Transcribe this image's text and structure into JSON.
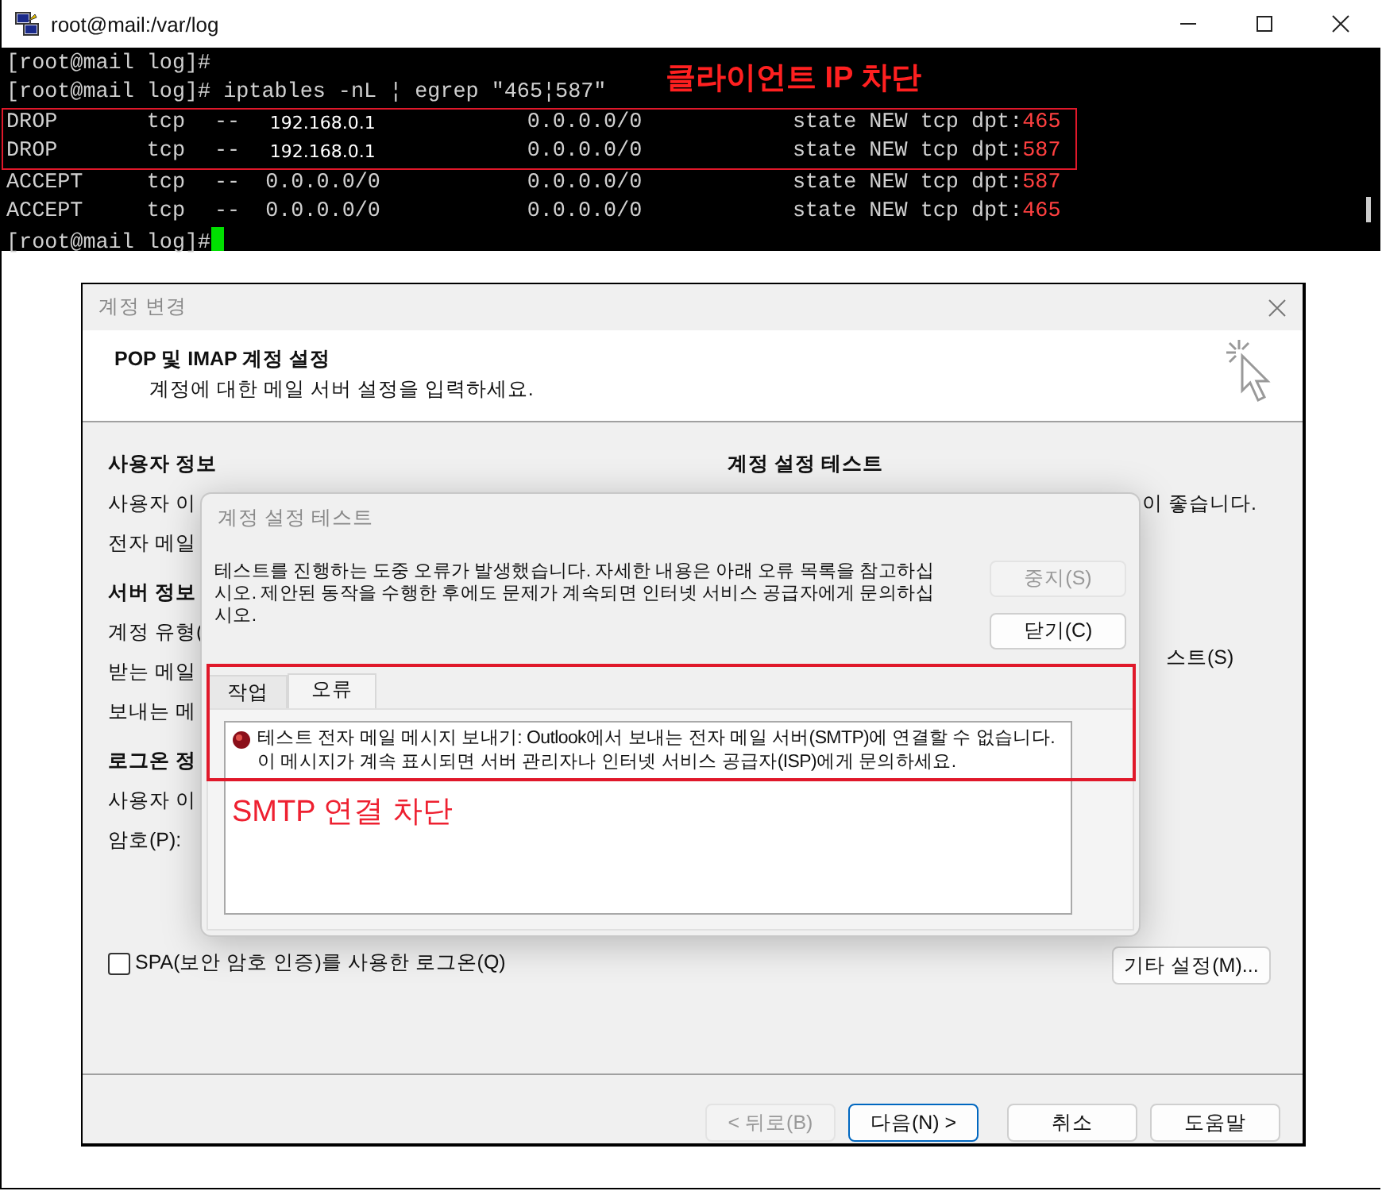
{
  "terminal": {
    "title": "root@mail:/var/log",
    "lines": [
      "[root@mail log]#",
      "[root@mail log]# iptables -nL ¦ egrep \"465¦587\""
    ],
    "annotation": "클라이언트 IP 차단",
    "rules": [
      {
        "target": "DROP",
        "prot": "tcp",
        "opt": "--",
        "source": "192.168.0.1",
        "destination": "0.0.0.0/0",
        "match": "state NEW tcp dpt:",
        "port": "465",
        "boxed": true
      },
      {
        "target": "DROP",
        "prot": "tcp",
        "opt": "--",
        "source": "192.168.0.1",
        "destination": "0.0.0.0/0",
        "match": "state NEW tcp dpt:",
        "port": "587",
        "boxed": true
      },
      {
        "target": "ACCEPT",
        "prot": "tcp",
        "opt": "--",
        "source": "0.0.0.0/0",
        "destination": "0.0.0.0/0",
        "match": "state NEW tcp dpt:",
        "port": "587",
        "boxed": false
      },
      {
        "target": "ACCEPT",
        "prot": "tcp",
        "opt": "--",
        "source": "0.0.0.0/0",
        "destination": "0.0.0.0/0",
        "match": "state NEW tcp dpt:",
        "port": "465",
        "boxed": false
      }
    ],
    "prompt": "[root@mail log]#"
  },
  "account_dialog": {
    "title": "계정 변경",
    "heading": "POP 및 IMAP 계정 설정",
    "subheading": "계정에 대한 메일 서버 설정을 입력하세요.",
    "left": [
      {
        "kind": "section",
        "text": "사용자 정보"
      },
      {
        "kind": "label",
        "text": "사용자 이"
      },
      {
        "kind": "label",
        "text": "전자 메일"
      },
      {
        "kind": "section",
        "text": "서버 정보"
      },
      {
        "kind": "label",
        "text": "계정 유형("
      },
      {
        "kind": "label",
        "text": "받는 메일"
      },
      {
        "kind": "label",
        "text": "보내는 메"
      },
      {
        "kind": "section",
        "text": "로그온 정"
      },
      {
        "kind": "label",
        "text": "사용자 이"
      },
      {
        "kind": "label",
        "text": "암호(P):"
      }
    ],
    "right": [
      {
        "kind": "section",
        "text": "계정 설정 테스트"
      },
      {
        "kind": "label",
        "text": "이 좋습니다."
      },
      {
        "kind": "label",
        "text": "스트(S)"
      }
    ],
    "checkbox": {
      "label": "SPA(보안 암호 인증)를 사용한 로그온(Q)",
      "checked": false
    },
    "more_button": "기타 설정(M)...",
    "footer_buttons": [
      {
        "label": "< 뒤로(B)",
        "disabled": true,
        "default": false
      },
      {
        "label": "다음(N) >",
        "disabled": false,
        "default": true
      },
      {
        "label": "취소",
        "disabled": false,
        "default": false
      },
      {
        "label": "도움말",
        "disabled": false,
        "default": false
      }
    ]
  },
  "test_dialog": {
    "title": "계정 설정 테스트",
    "message": "테스트를 진행하는 도중 오류가 발생했습니다. 자세한 내용은 아래 오류 목록을 참고하십시오. 제안된 동작을 수행한 후에도 문제가 계속되면 인터넷 서비스 공급자에게 문의하십시오.",
    "buttons": [
      {
        "label": "중지(S)",
        "disabled": true
      },
      {
        "label": "닫기(C)",
        "disabled": false
      }
    ],
    "tabs": [
      {
        "label": "작업",
        "selected": false
      },
      {
        "label": "오류",
        "selected": true
      }
    ],
    "errors": [
      "테스트 전자 메일 메시지 보내기: Outlook에서 보내는 전자 메일 서버(SMTP)에 연결할 수 없습니다. 이 메시지가 계속 표시되면 서버 관리자나 인터넷 서비스 공급자(ISP)에게 문의하세요."
    ],
    "annotation": "SMTP 연결 차단"
  }
}
